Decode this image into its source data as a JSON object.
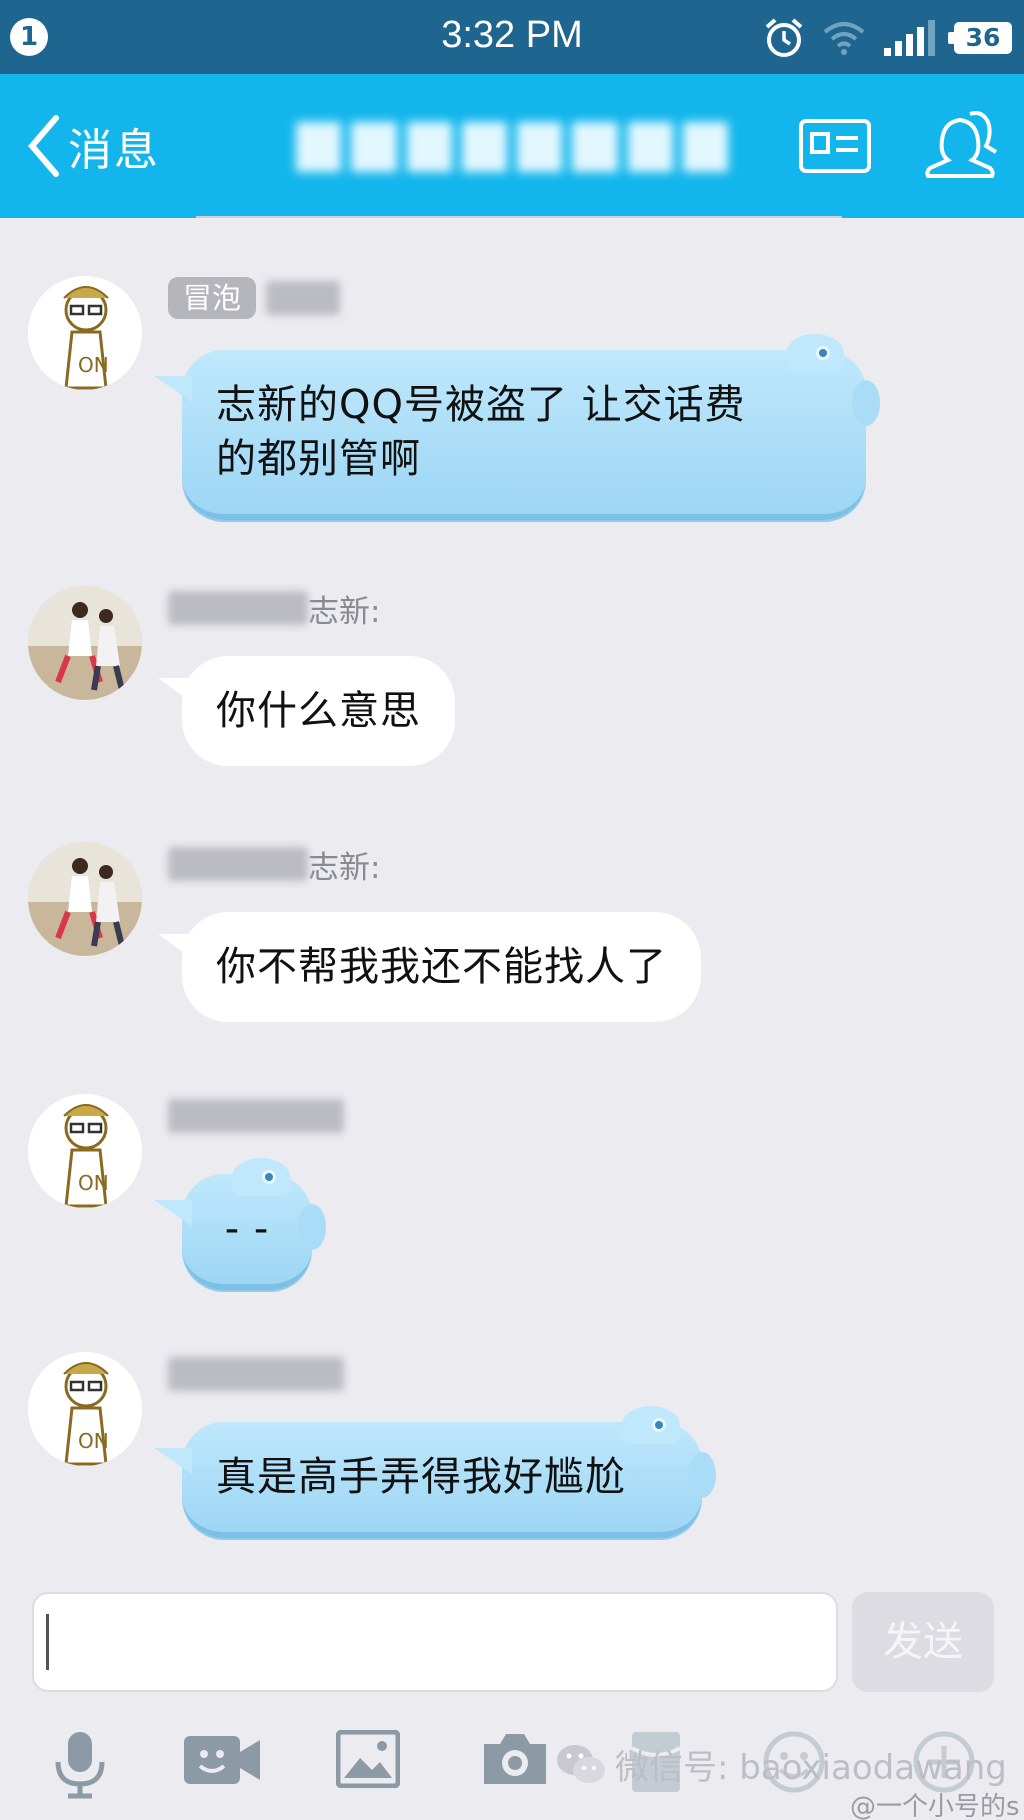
{
  "status_bar": {
    "notification_count": "1",
    "time": "3:32 PM",
    "battery": "36",
    "icons": [
      "alarm-icon",
      "wifi-icon",
      "signal-icon",
      "battery-icon"
    ]
  },
  "nav": {
    "back_label": "消息",
    "icons": [
      "profile-card-icon",
      "group-members-icon"
    ]
  },
  "messages": [
    {
      "sender_tag": "冒泡",
      "sender_name": "",
      "text_lines": [
        "志新的QQ号被盗了 让交话费",
        "的都别管啊"
      ],
      "style": "blue"
    },
    {
      "sender_tag": "",
      "sender_name": "志新:",
      "text_lines": [
        "你什么意思"
      ],
      "style": "white"
    },
    {
      "sender_tag": "",
      "sender_name": "志新:",
      "text_lines": [
        "你不帮我我还不能找人了"
      ],
      "style": "white"
    },
    {
      "sender_tag": "",
      "sender_name": "",
      "text_lines": [
        "- -"
      ],
      "style": "blue"
    },
    {
      "sender_tag": "",
      "sender_name": "",
      "text_lines": [
        "真是高手弄得我好尴尬"
      ],
      "style": "blue"
    }
  ],
  "input": {
    "value": "",
    "send_label": "发送"
  },
  "toolbar": {
    "icons": [
      "microphone-icon",
      "video-call-icon",
      "image-icon",
      "camera-icon",
      "red-packet-icon",
      "emoji-icon",
      "plus-icon"
    ]
  },
  "watermark": {
    "text": "微信号: baoxiaodawang",
    "credit": "@一个小号的s"
  },
  "colors": {
    "status_bar": "#1e6690",
    "nav_bar": "#13b6ec",
    "background": "#ebebf0",
    "blue_bubble": "#bfe8fc",
    "white_bubble": "#ffffff"
  }
}
